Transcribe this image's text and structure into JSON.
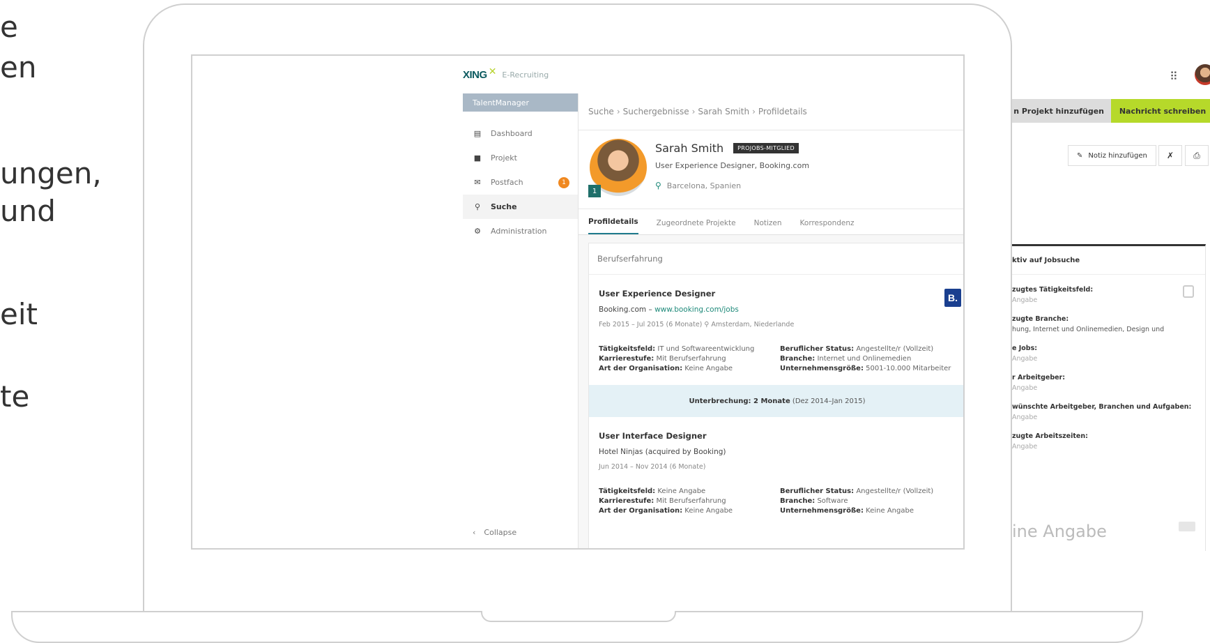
{
  "left_text": [
    "e",
    "en",
    "ungen,",
    "und",
    "eit",
    "te"
  ],
  "app": {
    "logo": "XING",
    "logo_sub": "E-Recruiting",
    "product": "TalentManager"
  },
  "sidebar": {
    "items": [
      {
        "label": "Dashboard",
        "icon": "dashboard-icon"
      },
      {
        "label": "Projekt",
        "icon": "folder-icon"
      },
      {
        "label": "Postfach",
        "icon": "mail-icon",
        "badge": "1"
      },
      {
        "label": "Suche",
        "icon": "search-icon",
        "active": true
      },
      {
        "label": "Administration",
        "icon": "gear-icon"
      }
    ],
    "collapse_label": "Collapse"
  },
  "breadcrumb": [
    "Suche",
    "Suchergebnisse",
    "Sarah Smith",
    "Profildetails"
  ],
  "profile": {
    "name": "Sarah Smith",
    "badge": "PROJOBS-MITGLIED",
    "title": "User Experience Designer, Booking.com",
    "location": "Barcelona, Spanien",
    "level": "1"
  },
  "tabs": [
    "Profildetails",
    "Zugeordnete Projekte",
    "Notizen",
    "Korrespondenz"
  ],
  "experience": {
    "heading": "Berufserfahrung",
    "jobs": [
      {
        "title": "User Experience Designer",
        "company": "Booking.com",
        "link": "www.booking.com/jobs",
        "dates": "Feb 2015 – Jul 2015 (6 Monate)",
        "location": "Amsterdam, Niederlande",
        "logo": "B.",
        "left": [
          {
            "k": "Tätigkeitsfeld:",
            "v": "IT und Softwareentwicklung"
          },
          {
            "k": "Karrierestufe:",
            "v": "Mit Berufserfahrung"
          },
          {
            "k": "Art der Organisation:",
            "v": "Keine Angabe"
          }
        ],
        "right": [
          {
            "k": "Beruflicher Status:",
            "v": "Angestellte/r (Vollzeit)"
          },
          {
            "k": "Branche:",
            "v": "Internet und Onlinemedien"
          },
          {
            "k": "Unternehmensgröße:",
            "v": "5001-10.000 Mitarbeiter"
          }
        ]
      },
      {
        "title": "User Interface Designer",
        "company": "Hotel Ninjas (acquired by Booking)",
        "link": "",
        "dates": "Jun 2014 – Nov 2014 (6 Monate)",
        "location": "",
        "left": [
          {
            "k": "Tätigkeitsfeld:",
            "v": "Keine Angabe"
          },
          {
            "k": "Karrierestufe:",
            "v": "Mit Berufserfahrung"
          },
          {
            "k": "Art der Organisation:",
            "v": "Keine Angabe"
          }
        ],
        "right": [
          {
            "k": "Beruflicher Status:",
            "v": "Angestellte/r (Vollzeit)"
          },
          {
            "k": "Branche:",
            "v": "Software"
          },
          {
            "k": "Unternehmensgröße:",
            "v": "Keine Angabe"
          }
        ]
      }
    ],
    "gap": {
      "label": "Unterbrechung: 2 Monate",
      "range": "(Dez 2014–Jan 2015)"
    }
  },
  "right_panel": {
    "btn_project": "n Projekt hinzufügen",
    "btn_message": "Nachricht schreiben",
    "btn_note": "Notiz hinzufügen",
    "card_head": "ktiv auf Jobsuche",
    "fields": [
      {
        "label": "zugtes Tätigkeitsfeld:",
        "value": "Angabe"
      },
      {
        "label": "zugte Branche:",
        "value": "hung, Internet und Onlinemedien, Design und"
      },
      {
        "label": "e Jobs:",
        "value": "Angabe"
      },
      {
        "label": "r Arbeitgeber:",
        "value": "Angabe"
      },
      {
        "label": "wünschte Arbeitgeber, Branchen und Aufgaben:",
        "value": "Angabe"
      },
      {
        "label": "zugte Arbeitszeiten:",
        "value": "Angabe"
      }
    ],
    "big_text": "ine Angabe"
  },
  "colors": {
    "accent_green": "#b6d92a",
    "orange_badge": "#f0881f",
    "teal": "#1f8a7a",
    "booking_blue": "#1a3f8f"
  }
}
